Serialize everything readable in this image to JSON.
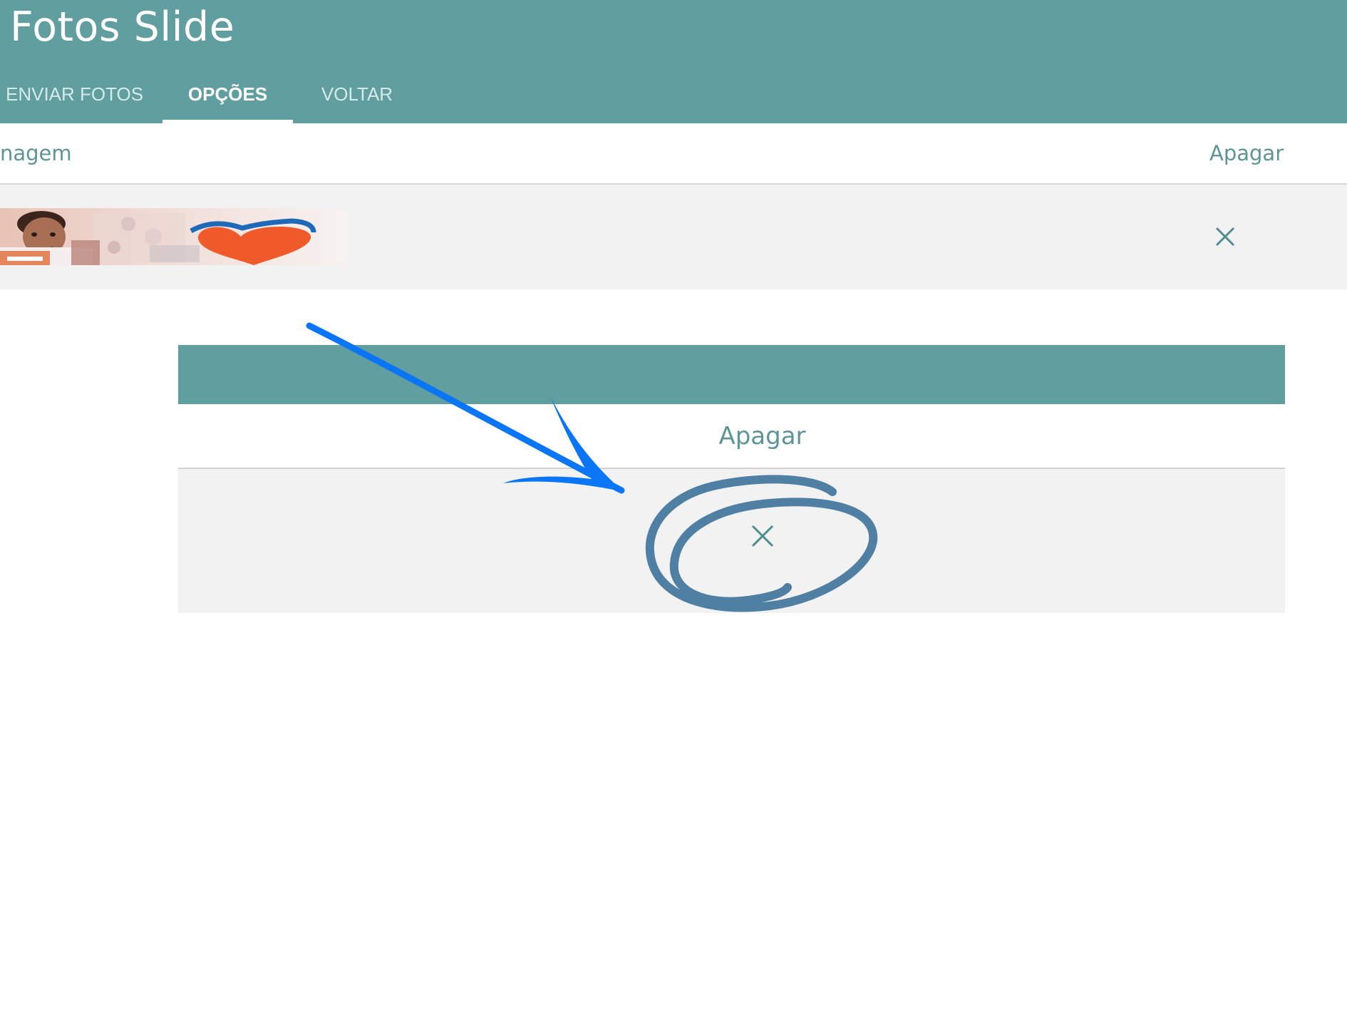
{
  "header": {
    "title": "Fotos Slide",
    "background_color": "#609e9f"
  },
  "tabs": [
    {
      "label": "ENVIAR FOTOS",
      "active": false
    },
    {
      "label": "OPÇÕES",
      "active": true
    },
    {
      "label": "VOLTAR",
      "active": false
    }
  ],
  "table": {
    "columns": {
      "image_label": "nagem",
      "delete_label": "Apagar"
    },
    "rows": [
      {
        "thumbnail": "photo-thumbnail",
        "delete_icon": "close-icon"
      }
    ]
  },
  "zoom": {
    "delete_label": "Apagar",
    "delete_icon": "close-icon"
  },
  "annotations": {
    "arrow_color": "#0a76f6",
    "circle_color": "#4f7fa3"
  },
  "colors": {
    "accent": "#609e9f",
    "row_background": "#f2f2f2",
    "label_color": "#5d9597"
  }
}
